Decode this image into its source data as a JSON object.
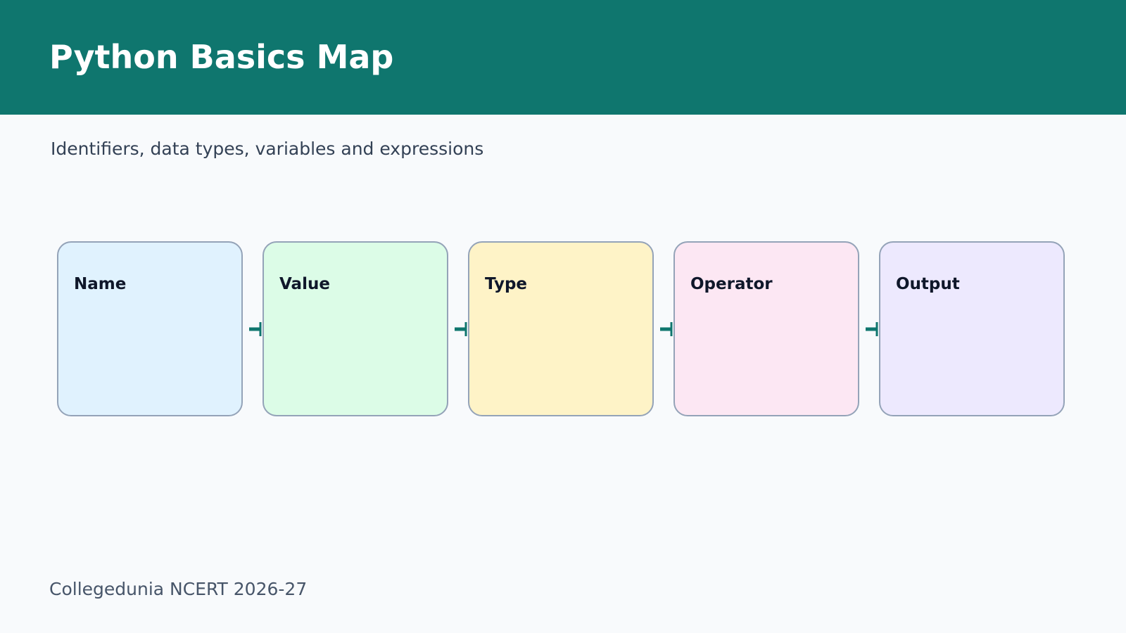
{
  "header": {
    "title": "Python Basics Map"
  },
  "subtitle": "Identifiers, data types, variables and expressions",
  "nodes": [
    {
      "label": "Name",
      "color": "#e0f2fe"
    },
    {
      "label": "Value",
      "color": "#dcfce7"
    },
    {
      "label": "Type",
      "color": "#fef3c7"
    },
    {
      "label": "Operator",
      "color": "#fce7f3"
    },
    {
      "label": "Output",
      "color": "#ede9fe"
    }
  ],
  "colors": {
    "header": "#0f766e",
    "connector": "#0f766e",
    "border": "#94a3b8"
  },
  "footer": "Collegedunia NCERT 2026-27"
}
